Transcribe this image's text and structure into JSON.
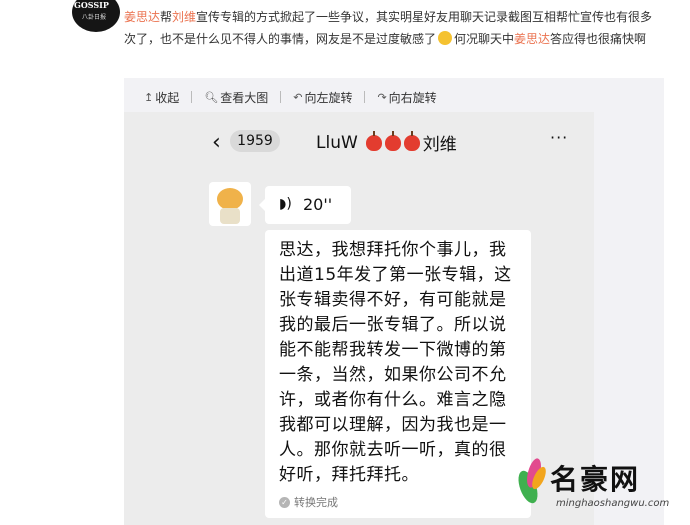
{
  "author": {
    "logo_text": "GOSSIP",
    "logo_sub": "八卦日报"
  },
  "post": {
    "segments": [
      {
        "text": "姜思达",
        "mention": true
      },
      {
        "text": "帮",
        "mention": false
      },
      {
        "text": "刘维",
        "mention": true
      },
      {
        "text": "宣传专辑的方式掀起了一些争议，其实明星好友用聊天记录截图互相帮忙宣传也有很多次了，也不是什么见不得人的事情，网友是不是过度敏感了",
        "mention": false
      }
    ],
    "after_emoji": [
      {
        "text": "何况聊天中",
        "mention": false
      },
      {
        "text": "姜思达",
        "mention": true
      },
      {
        "text": "答应得也很痛快啊",
        "mention": false
      }
    ]
  },
  "toolbar": {
    "collapse": "收起",
    "view_large": "查看大图",
    "rotate_left": "向左旋转",
    "rotate_right": "向右旋转"
  },
  "chat": {
    "unread_count": "1959",
    "contact_name": "LluW",
    "contact_name_cn": "刘维",
    "more": "···",
    "voice_duration": "20''",
    "message": "思达，我想拜托你个事儿，我出道15年发了第一张专辑，这张专辑卖得不好，有可能就是我的最后一张专辑了。所以说能不能帮我转发一下微博的第一条，当然，如果你公司不允许，或者你有什么。难言之隐我都可以理解，因为我也是一人。那你就去听一听，真的很好听，拜托拜托。",
    "converted_label": "转换完成"
  },
  "watermark": {
    "name": "名豪网",
    "url": "minghaoshangwu.com"
  },
  "colors": {
    "mention": "#eb7350",
    "card_bg": "#f2f2f5",
    "chat_bg": "#ececec"
  }
}
